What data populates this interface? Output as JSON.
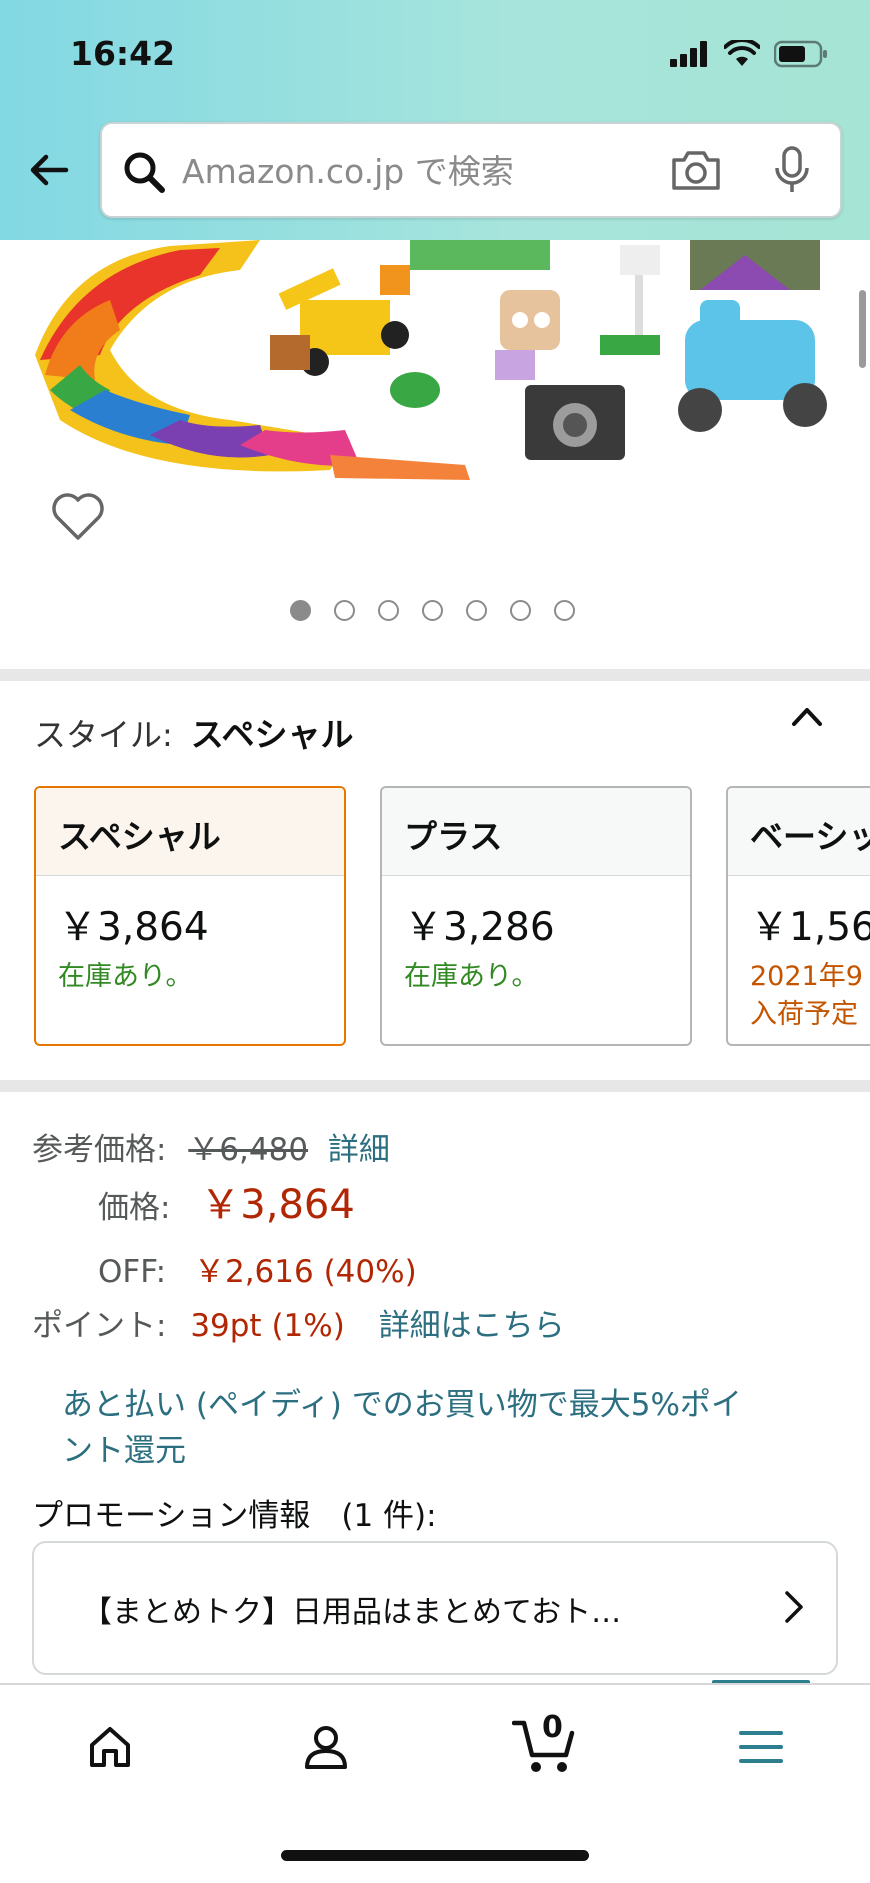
{
  "status_bar": {
    "time": "16:42"
  },
  "search": {
    "placeholder": "Amazon.co.jp で検索"
  },
  "gallery": {
    "dot_count": 7,
    "active_index": 0
  },
  "style_selector": {
    "label": "スタイル:",
    "selected": "スペシャル",
    "options": [
      {
        "title": "スペシャル",
        "price": "￥3,864",
        "stock": "在庫あり。",
        "stock2": ""
      },
      {
        "title": "プラス",
        "price": "￥3,286",
        "stock": "在庫あり。",
        "stock2": ""
      },
      {
        "title": "ベーシッ",
        "price": "￥1,56",
        "stock": "2021年9",
        "stock2": "入荷予定"
      }
    ]
  },
  "pricing": {
    "ref_label": "参考価格:",
    "ref_price": "￥6,480",
    "ref_detail": "詳細",
    "price_label": "価格:",
    "price": "￥3,864",
    "off_label": "OFF:",
    "off_value": "￥2,616 (40%)",
    "points_label": "ポイント:",
    "points_value": "39pt  (1%)",
    "points_link": "詳細はこちら",
    "paidy_line1": "あと払い (ペイディ) でのお買い物で最大5%ポイ",
    "paidy_line2": "ント還元",
    "promo_heading": "プロモーション情報　(1 件):",
    "promo_text": "【まとめトク】日用品はまとめておト…"
  },
  "tabbar": {
    "cart_count": "0"
  },
  "colors": {
    "accent": "#e77600",
    "link": "#2c6f80",
    "price_red": "#b12704",
    "stock_green": "#338a24"
  }
}
